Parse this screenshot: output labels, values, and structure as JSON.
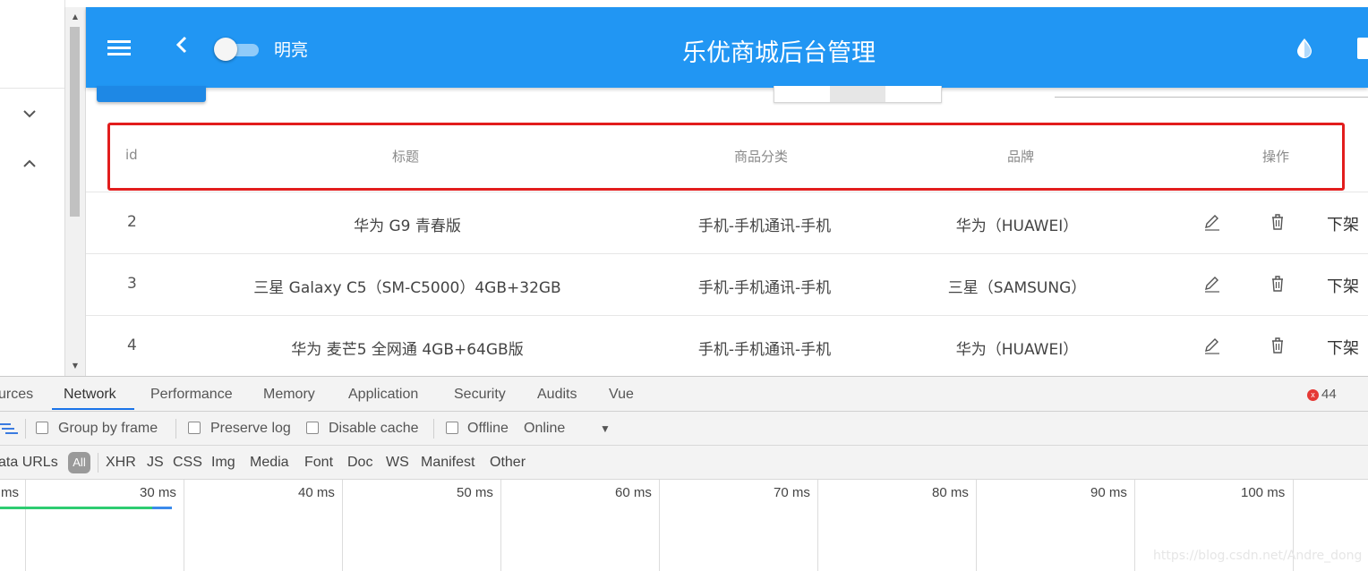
{
  "header": {
    "theme_label": "明亮",
    "title": "乐优商城后台管理",
    "primary_color": "#2196f3"
  },
  "table": {
    "columns": [
      "id",
      "标题",
      "商品分类",
      "品牌",
      "操作"
    ],
    "rows": [
      {
        "id": "2",
        "title": "华为 G9 青春版",
        "category": "手机-手机通讯-手机",
        "brand": "华为（HUAWEI）",
        "action": "下架"
      },
      {
        "id": "3",
        "title": "三星 Galaxy C5（SM-C5000）4GB+32GB",
        "category": "手机-手机通讯-手机",
        "brand": "三星（SAMSUNG）",
        "action": "下架"
      },
      {
        "id": "4",
        "title": "华为 麦芒5 全网通 4GB+64GB版",
        "category": "手机-手机通讯-手机",
        "brand": "华为（HUAWEI）",
        "action": "下架"
      }
    ],
    "highlight_color": "#e21d1d"
  },
  "devtools": {
    "tabs": [
      "urces",
      "Network",
      "Performance",
      "Memory",
      "Application",
      "Security",
      "Audits",
      "Vue"
    ],
    "active_tab": "Network",
    "error_count": "44",
    "error_icon": "x",
    "toolbar": {
      "group_by_frame": "Group by frame",
      "preserve_log": "Preserve log",
      "disable_cache": "Disable cache",
      "offline": "Offline",
      "throttle": "Online",
      "dropdown_glyph": "▼"
    },
    "filter": {
      "data_urls": "ata URLs",
      "all": "All",
      "types": [
        "XHR",
        "JS",
        "CSS",
        "Img",
        "Media",
        "Font",
        "Doc",
        "WS",
        "Manifest",
        "Other"
      ]
    },
    "timeline_labels": [
      "ms",
      "30 ms",
      "40 ms",
      "50 ms",
      "60 ms",
      "70 ms",
      "80 ms",
      "90 ms",
      "100 ms"
    ]
  },
  "watermark": "https://blog.csdn.net/Andre_dong",
  "icons": [
    "menu-icon",
    "back-icon",
    "theme-toggle",
    "drop-icon",
    "exit-icon",
    "edit-icon",
    "delete-icon",
    "chevron-down-icon",
    "chevron-up-icon",
    "filter-icon",
    "error-icon"
  ]
}
